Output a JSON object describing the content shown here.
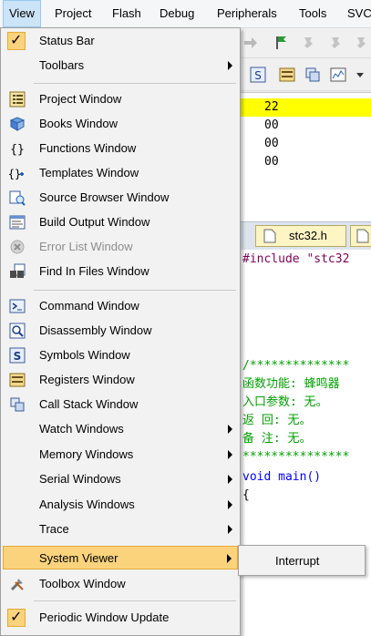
{
  "menubar": {
    "items": [
      "View",
      "Project",
      "Flash",
      "Debug",
      "Peripherals",
      "Tools",
      "SVC"
    ]
  },
  "view_menu": {
    "items": [
      {
        "label": "Status Bar",
        "checked": true
      },
      {
        "label": "Toolbars",
        "submenu": true
      },
      {
        "label": "Project Window",
        "icon": "project-window-icon"
      },
      {
        "label": "Books Window",
        "icon": "books-window-icon"
      },
      {
        "label": "Functions Window",
        "icon": "functions-window-icon"
      },
      {
        "label": "Templates Window",
        "icon": "templates-window-icon"
      },
      {
        "label": "Source Browser Window",
        "icon": "source-browser-icon"
      },
      {
        "label": "Build Output Window",
        "icon": "build-output-icon"
      },
      {
        "label": "Error List Window",
        "icon": "error-list-icon",
        "disabled": true
      },
      {
        "label": "Find In Files Window",
        "icon": "find-in-files-icon"
      },
      {
        "label": "Command Window",
        "icon": "command-window-icon"
      },
      {
        "label": "Disassembly Window",
        "icon": "disassembly-window-icon"
      },
      {
        "label": "Symbols Window",
        "icon": "symbols-window-icon"
      },
      {
        "label": "Registers Window",
        "icon": "registers-window-icon"
      },
      {
        "label": "Call Stack Window",
        "icon": "call-stack-icon"
      },
      {
        "label": "Watch Windows",
        "submenu": true
      },
      {
        "label": "Memory Windows",
        "submenu": true
      },
      {
        "label": "Serial Windows",
        "submenu": true
      },
      {
        "label": "Analysis Windows",
        "submenu": true
      },
      {
        "label": "Trace",
        "submenu": true
      },
      {
        "label": "System Viewer",
        "submenu": true,
        "highlighted": true
      },
      {
        "label": "Toolbox Window",
        "icon": "toolbox-icon"
      },
      {
        "label": "Periodic Window Update",
        "checked": true
      }
    ]
  },
  "submenu_system_viewer": {
    "items": [
      "Interrupt"
    ]
  },
  "memory_view": {
    "lines": [
      "22",
      "00",
      "00",
      "00"
    ]
  },
  "editor": {
    "tab_label": "stc32.h",
    "lines": [
      "#include \"stc32",
      "",
      "",
      "/**************",
      "函数功能: 蜂鸣器",
      "入口参数: 无。",
      "返    回: 无。",
      "备    注: 无。",
      "***************",
      "void main()",
      "{"
    ]
  },
  "colors": {
    "highlight": "#fbd37d",
    "highlight_border": "#e5a93a",
    "menubar_active": "#cce4f7",
    "memory_highlight": "#ffff00",
    "comment": "#00a000",
    "keyword": "#0000ff"
  }
}
